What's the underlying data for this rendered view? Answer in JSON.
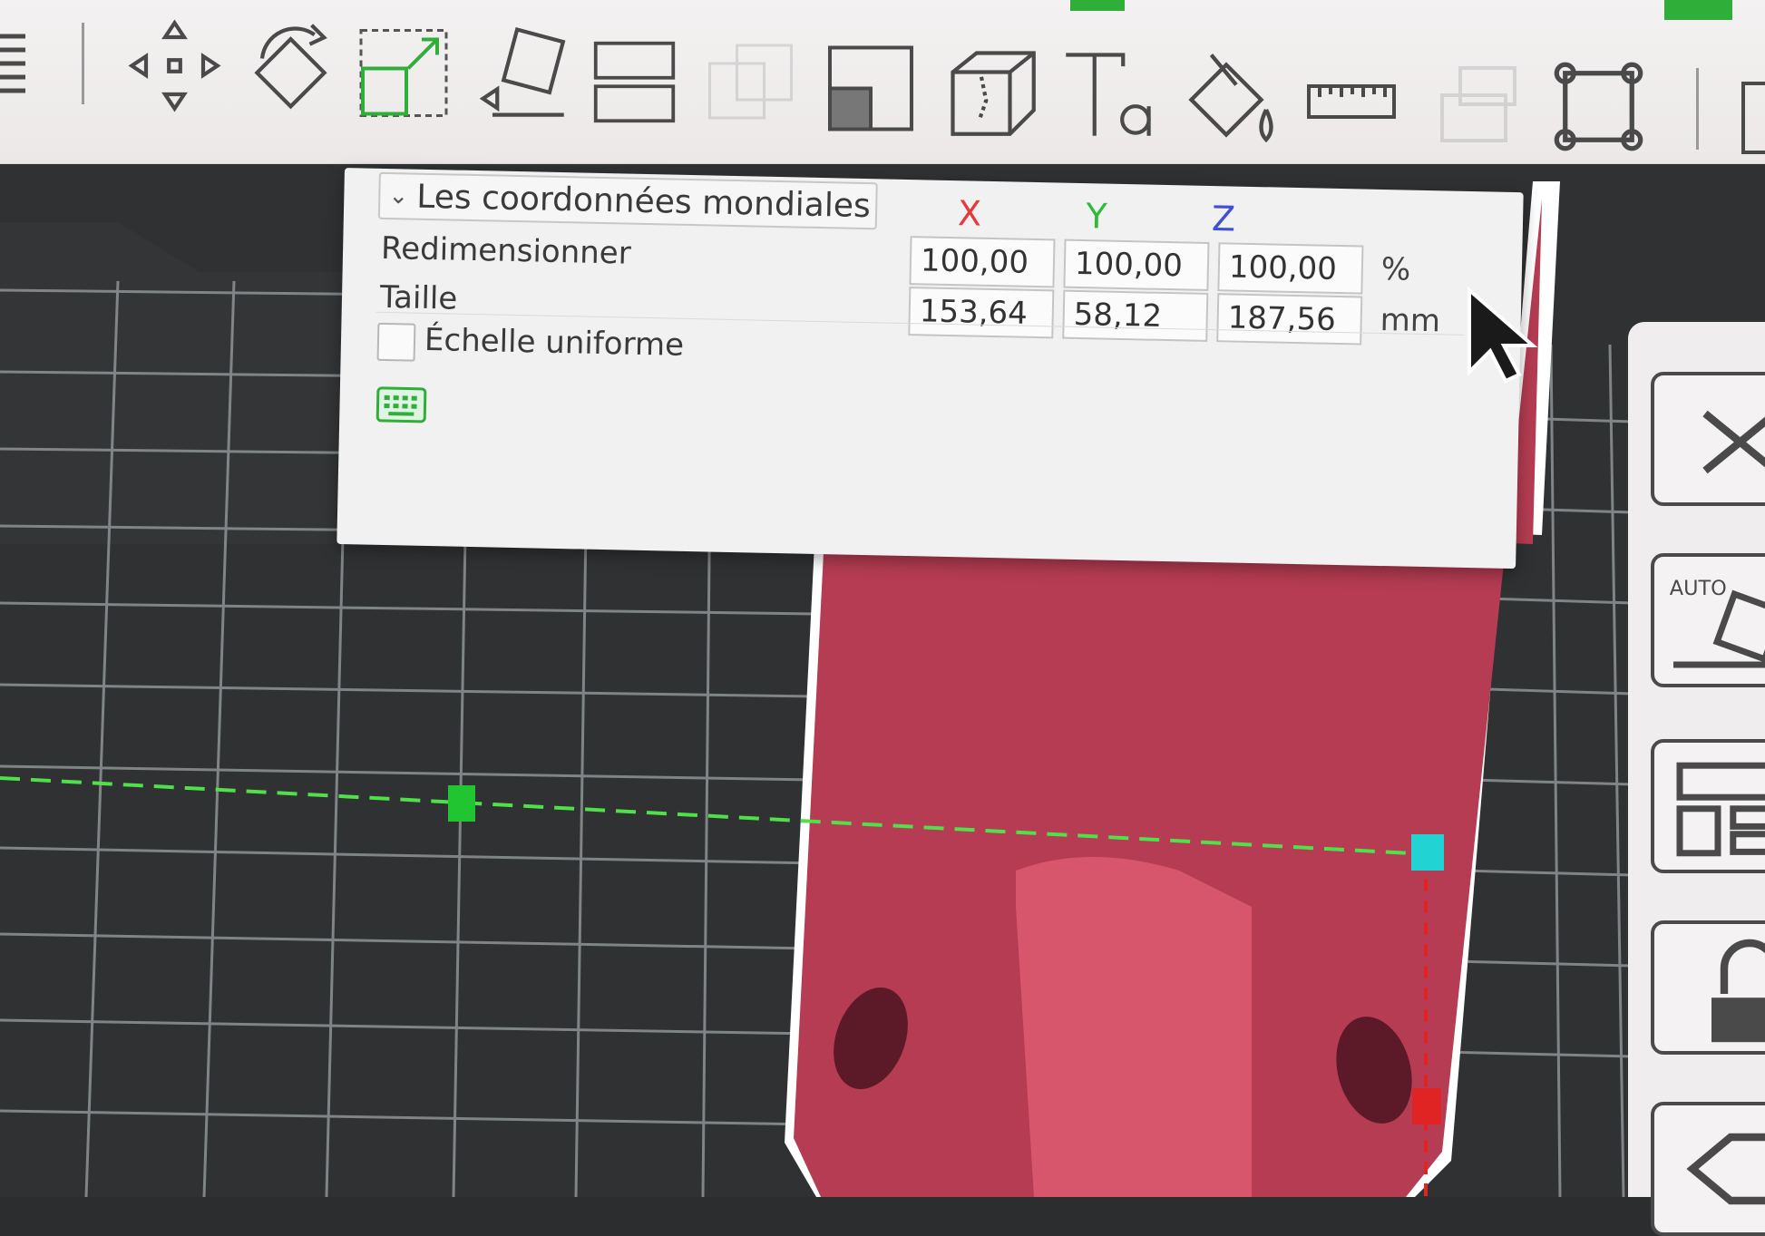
{
  "toolbar": {
    "icons": [
      "menu-icon",
      "move-icon",
      "rotate-icon",
      "scale-icon",
      "lay-on-face-icon",
      "cut-icon",
      "boolean-icon",
      "support-paint-icon",
      "seam-paint-icon",
      "text-icon",
      "color-paint-icon",
      "measure-icon",
      "assembly-icon",
      "fit-view-icon"
    ],
    "active_tool": "scale-icon"
  },
  "scale_panel": {
    "coordinate_mode": "Les coordonnées mondiales",
    "axes": {
      "x": "X",
      "y": "Y",
      "z": "Z"
    },
    "axis_colors": {
      "x": "#e23b3b",
      "y": "#2dbb3a",
      "z": "#3f4fd8"
    },
    "rows": {
      "resize": {
        "label": "Redimensionner",
        "x": "100,00",
        "y": "100,00",
        "z": "100,00",
        "unit": "%"
      },
      "size": {
        "label": "Taille",
        "x": "153,64",
        "y": "58,12",
        "z": "187,56",
        "unit": "mm"
      }
    },
    "uniform_scale": {
      "label": "Échelle uniforme",
      "checked": false
    },
    "keyboard_icon": "keyboard-icon"
  },
  "viewport": {
    "plate_color": "#2f3133",
    "grid_color": "#8f9496",
    "model_color": "#c44a5f",
    "measure_line_color": "#4fe04a",
    "handle_colors": [
      "#21c531",
      "#22d3d3",
      "#e02424"
    ]
  },
  "side_panel": {
    "icons": [
      "close-icon",
      "auto-orient-icon",
      "arrange-icon",
      "lock-icon",
      "label-icon"
    ]
  },
  "cursor_icon": "arrow-cursor-icon"
}
